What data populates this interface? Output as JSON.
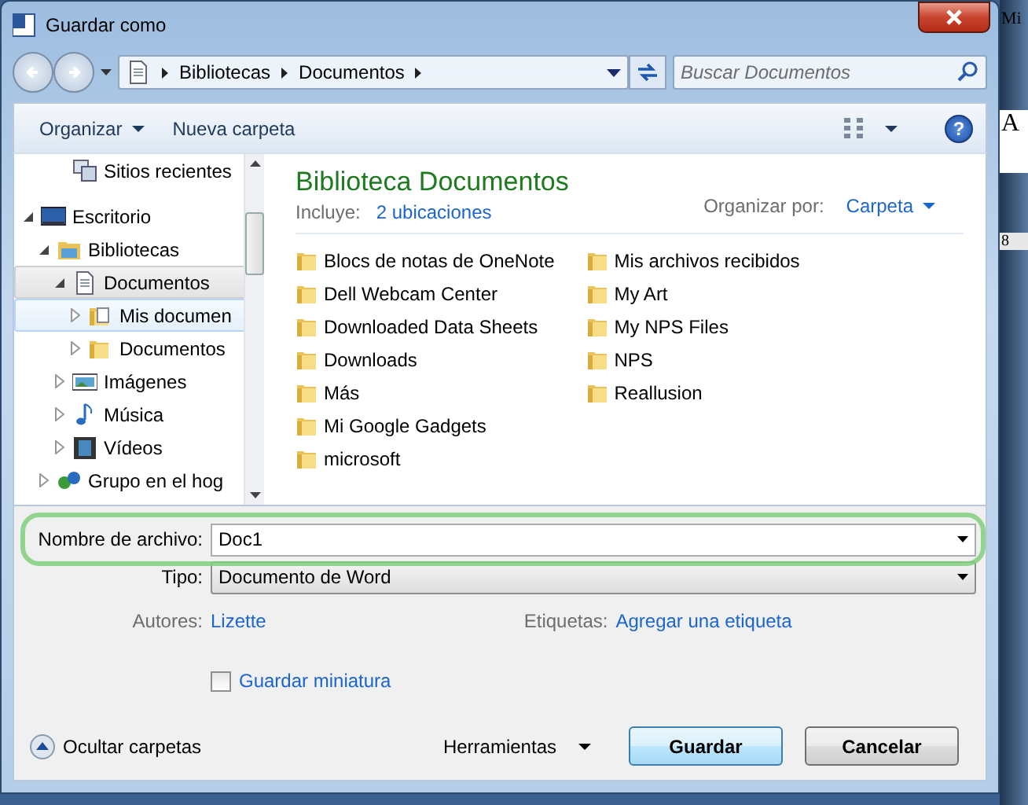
{
  "window": {
    "title": "Guardar como"
  },
  "address": {
    "crumbs": [
      "Bibliotecas",
      "Documentos"
    ],
    "search_placeholder": "Buscar Documentos"
  },
  "toolbar": {
    "organize": "Organizar",
    "new_folder": "Nueva carpeta",
    "help": "?"
  },
  "favorites": [
    {
      "label": "Sitios recientes",
      "kind": "recent"
    }
  ],
  "tree": [
    {
      "label": "Escritorio",
      "kind": "desktop",
      "expanded": true,
      "selected": false,
      "hovered": false,
      "children": [
        {
          "label": "Bibliotecas",
          "kind": "library",
          "expanded": true,
          "selected": false,
          "hovered": false,
          "children": [
            {
              "label": "Documentos",
              "kind": "document",
              "expanded": true,
              "selected": true,
              "hovered": false,
              "children": [
                {
                  "label": "Mis documen",
                  "kind": "docfolder",
                  "expanded": false,
                  "selected": false,
                  "hovered": true
                },
                {
                  "label": "Documentos",
                  "kind": "folder",
                  "expanded": false,
                  "selected": false,
                  "hovered": false
                }
              ]
            },
            {
              "label": "Imágenes",
              "kind": "pictures",
              "expanded": false,
              "selected": false,
              "hovered": false
            },
            {
              "label": "Música",
              "kind": "music",
              "expanded": false,
              "selected": false,
              "hovered": false
            },
            {
              "label": "Vídeos",
              "kind": "videos",
              "expanded": false,
              "selected": false,
              "hovered": false
            }
          ]
        },
        {
          "label": "Grupo en el hog",
          "kind": "homegroup",
          "expanded": false,
          "selected": false,
          "hovered": false
        }
      ]
    }
  ],
  "library": {
    "title": "Biblioteca Documentos",
    "includes_label": "Incluye:",
    "includes_link": "2 ubicaciones",
    "arrange_label": "Organizar por:",
    "arrange_value": "Carpeta"
  },
  "folders": [
    "Blocs de notas de OneNote",
    "Dell Webcam Center",
    "Downloaded Data Sheets",
    "Downloads",
    "Más",
    "Mi Google Gadgets",
    "microsoft",
    "Mis archivos recibidos",
    "My Art",
    "My NPS Files",
    "NPS",
    "Reallusion"
  ],
  "form": {
    "filename_label": "Nombre de archivo:",
    "filename": "Doc1",
    "filename_highlighted": true,
    "type_label": "Tipo:",
    "type": "Documento de Word",
    "authors_label": "Autores:",
    "authors": "Lizette",
    "tags_label": "Etiquetas:",
    "tags": "Agregar una etiqueta",
    "thumbnail_label": "Guardar miniatura",
    "thumbnail_checked": false
  },
  "footer": {
    "hide_folders": "Ocultar carpetas",
    "tools": "Herramientas",
    "save": "Guardar",
    "cancel": "Cancelar"
  },
  "background_window": {
    "texts": [
      "Mi",
      "A",
      "8"
    ]
  }
}
